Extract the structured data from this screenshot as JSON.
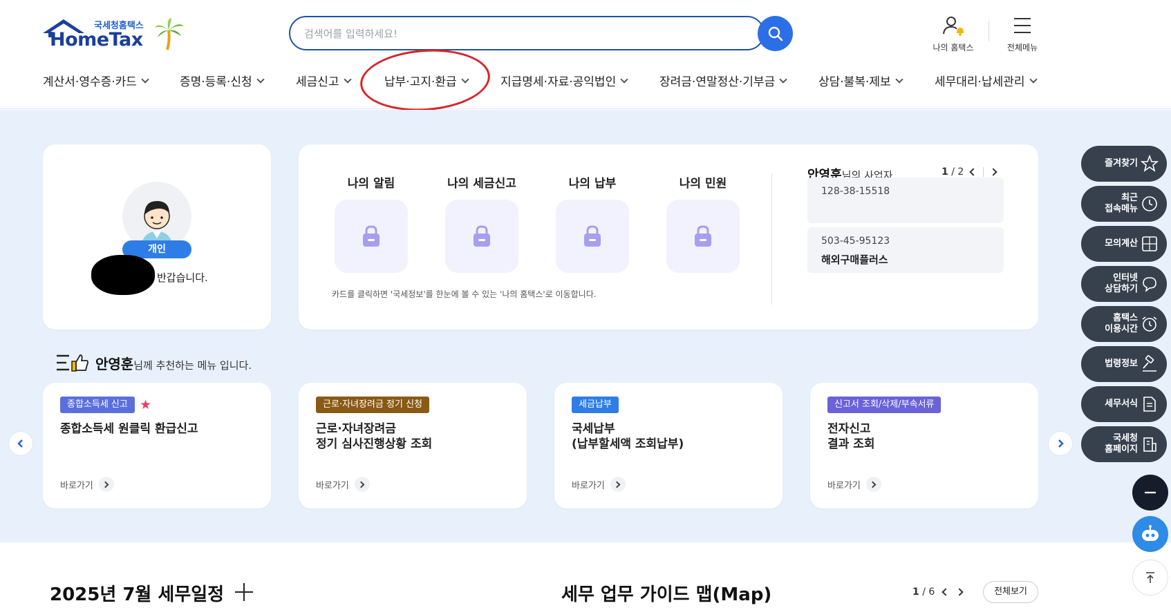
{
  "header": {
    "logo_top": "국세청홈택스",
    "logo_main": "HomeTax",
    "search_placeholder": "검색어를 입력하세요!",
    "my_hometax": "나의 홈택스",
    "all_menu": "전체메뉴"
  },
  "gnb": [
    "계산서·영수증·카드",
    "증명·등록·신청",
    "세금신고",
    "납부·고지·환급",
    "지급명세·자료·공익법인",
    "장려금·연말정산·기부금",
    "상담·불복·제보",
    "세무대리·납세관리"
  ],
  "profile": {
    "badge": "개인",
    "greeting": "반갑습니다."
  },
  "services": {
    "items": [
      "나의 알림",
      "나의 세금신고",
      "나의 납부",
      "나의 민원"
    ],
    "note": "카드를 클릭하면 '국세정보'를 한눈에 볼 수 있는 '나의 홈택스'로 이동합니다.",
    "owner_name": "안영훈",
    "owner_suffix": "님의 사업자",
    "pager_current": "1",
    "pager_total": "/ 2",
    "biz": [
      {
        "number": "128-38-15518",
        "name": ""
      },
      {
        "number": "503-45-95123",
        "name": "해외구매플러스"
      }
    ]
  },
  "recommend": {
    "name": "안영훈",
    "suffix": "님께 추천하는 메뉴 입니다.",
    "goto": "바로가기",
    "cards": [
      {
        "tag": "종합소득세 신고",
        "tag_color": "#5b6fdc",
        "title": "종합소득세 원클릭 환급신고",
        "starred": true
      },
      {
        "tag": "근로·자녀장려금 정기 신청",
        "tag_color": "#8a5a14",
        "title": "근로·자녀장려금\n정기 심사진행상황 조회",
        "starred": false
      },
      {
        "tag": "세금납부",
        "tag_color": "#2e7de6",
        "title": "국세납부\n(납부할세액 조회납부)",
        "starred": false
      },
      {
        "tag": "신고서 조회/삭제/부속서류",
        "tag_color": "#6a62d8",
        "title": "전자신고\n결과 조회",
        "starred": false
      }
    ]
  },
  "quick_menu": [
    {
      "label": "즐겨찾기",
      "icon": "star-icon"
    },
    {
      "label": "최근\n접속메뉴",
      "icon": "clock-icon"
    },
    {
      "label": "모의계산",
      "icon": "calculator-icon"
    },
    {
      "label": "인터넷\n상담하기",
      "icon": "chat-icon"
    },
    {
      "label": "홈택스\n이용시간",
      "icon": "alarm-icon"
    },
    {
      "label": "법령정보",
      "icon": "gavel-icon"
    },
    {
      "label": "세무서식",
      "icon": "document-icon"
    },
    {
      "label": "국세청\n홈페이지",
      "icon": "building-icon"
    }
  ],
  "bottom": {
    "schedule_title": "2025년 7월 세무일정",
    "guide_title": "세무 업무 가이드 맵(Map)",
    "pager_current": "1",
    "pager_total": "/ 6",
    "view_all": "전체보기"
  },
  "colors": {
    "brand_blue": "#2b6ee6",
    "band_bg": "#e8f1fb",
    "quick_menu_bg": "#37414d",
    "highlight_circle": "#d8232a"
  }
}
